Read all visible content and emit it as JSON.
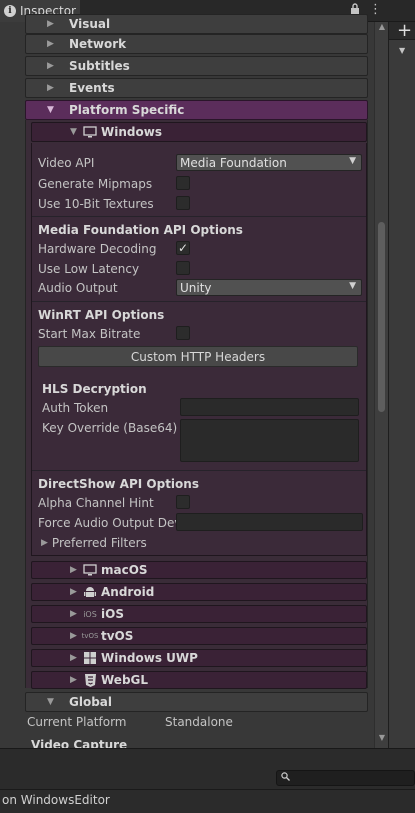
{
  "tab": {
    "title": "Inspector"
  },
  "icons": {
    "info": "info-icon",
    "lock": "lock-icon",
    "menu": "kebab-menu-icon",
    "add": "add-icon"
  },
  "sections": {
    "visual": "Visual",
    "network": "Network",
    "subtitles": "Subtitles",
    "events": "Events",
    "platform_specific": "Platform Specific",
    "global": "Global",
    "video_capture": "Video Capture"
  },
  "windows": {
    "header": "Windows",
    "video_api": {
      "label": "Video API",
      "value": "Media Foundation"
    },
    "generate_mipmaps": {
      "label": "Generate Mipmaps",
      "checked": false
    },
    "use_10bit": {
      "label": "Use 10-Bit Textures",
      "checked": false
    },
    "mf_title": "Media Foundation API Options",
    "hardware_decoding": {
      "label": "Hardware Decoding",
      "checked": true
    },
    "low_latency": {
      "label": "Use Low Latency",
      "checked": false
    },
    "audio_output": {
      "label": "Audio Output",
      "value": "Unity"
    },
    "winrt_title": "WinRT API Options",
    "start_max_bitrate": {
      "label": "Start Max Bitrate",
      "checked": false
    },
    "custom_http_button": "Custom HTTP Headers",
    "hls_title": "HLS Decryption",
    "auth_token": {
      "label": "Auth Token",
      "value": ""
    },
    "key_override": {
      "label": "Key Override (Base64)",
      "value": ""
    },
    "ds_title": "DirectShow API Options",
    "alpha_hint": {
      "label": "Alpha Channel Hint",
      "checked": false
    },
    "force_audio": {
      "label": "Force Audio Output Devi",
      "value": ""
    },
    "preferred_filters": "Preferred Filters"
  },
  "platforms": [
    {
      "label": "macOS",
      "icon": "monitor-icon"
    },
    {
      "label": "Android",
      "icon": "android-icon"
    },
    {
      "label": "iOS",
      "icon_text": "iOS"
    },
    {
      "label": "tvOS",
      "icon_text": "tvOS"
    },
    {
      "label": "Windows UWP",
      "icon": "windows-logo-icon"
    },
    {
      "label": "WebGL",
      "icon": "html5-icon"
    }
  ],
  "global": {
    "current_platform_label": "Current Platform",
    "current_platform_value": "Standalone"
  },
  "status": {
    "text": "on WindowsEditor"
  }
}
